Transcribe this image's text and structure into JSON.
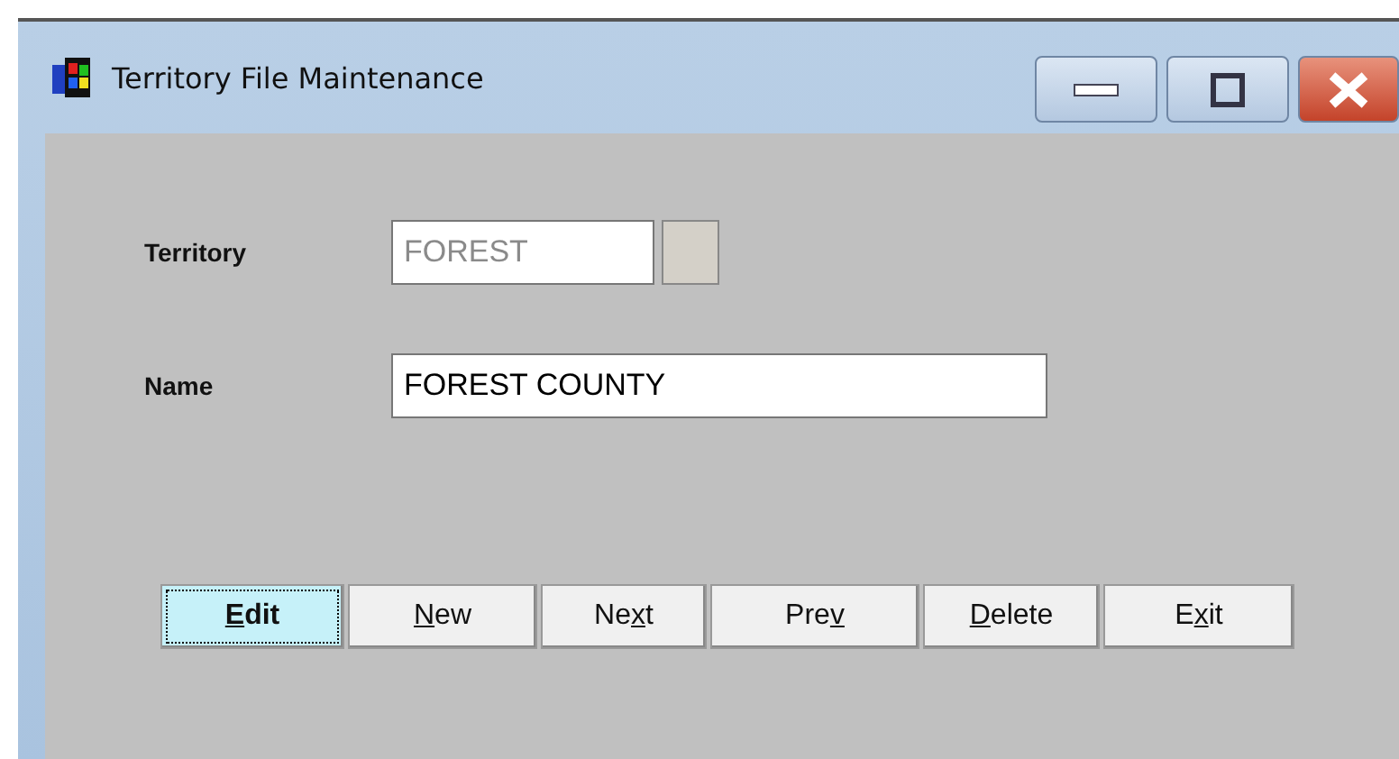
{
  "window": {
    "title": "Territory File Maintenance"
  },
  "fields": [
    {
      "label": "Territory",
      "value": "FOREST",
      "disabled": true,
      "has_lookup": true
    },
    {
      "label": "Name",
      "value": "FOREST COUNTY",
      "disabled": false,
      "has_lookup": false
    }
  ],
  "buttons": [
    {
      "key": "E",
      "post": "dit",
      "selected": true
    },
    {
      "key": "N",
      "post": "ew",
      "selected": false
    },
    {
      "pre": "Ne",
      "key": "x",
      "post": "t",
      "selected": false
    },
    {
      "pre": "Pre",
      "key": "v",
      "selected": false
    },
    {
      "key": "D",
      "post": "elete",
      "selected": false
    },
    {
      "pre": "E",
      "key": "x",
      "post": "it",
      "selected": false
    }
  ]
}
